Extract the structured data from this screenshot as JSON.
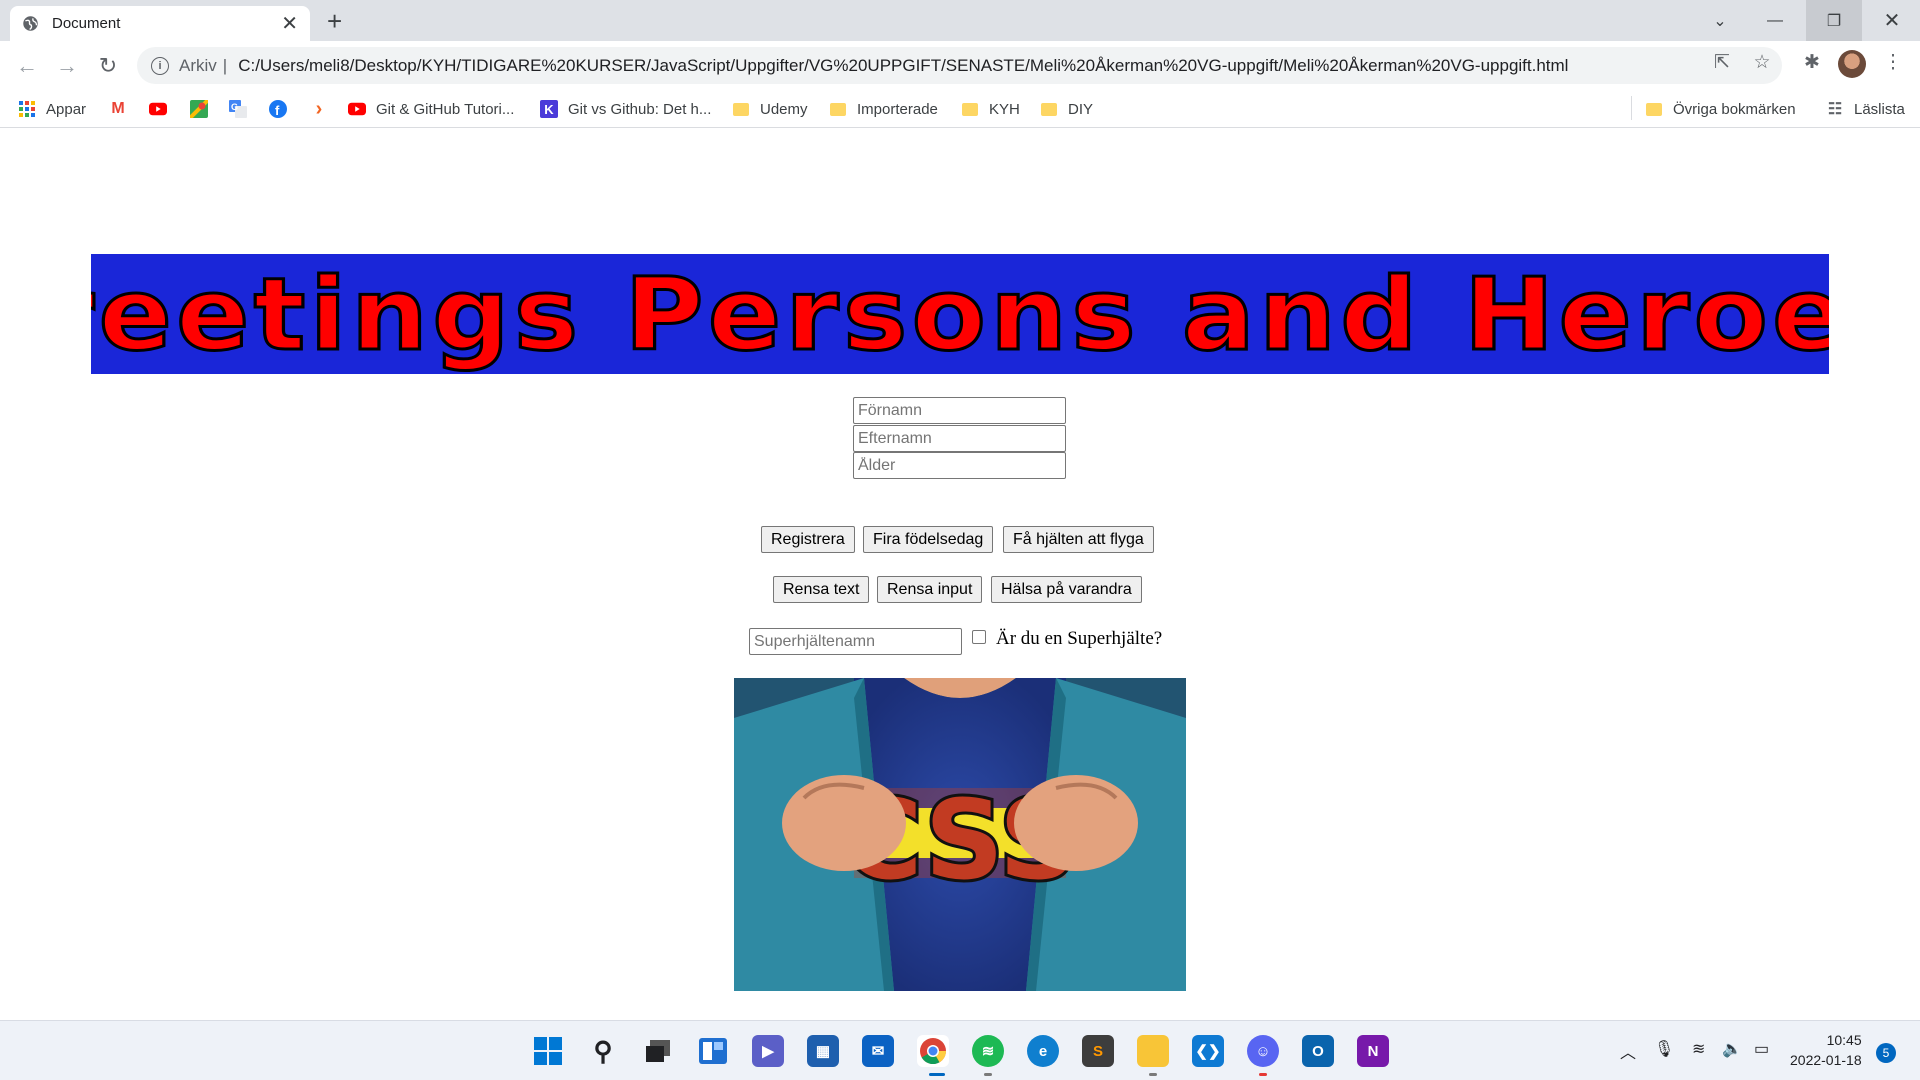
{
  "browser": {
    "tab_title": "Document",
    "address_scheme": "Arkiv",
    "address_url": "C:/Users/meli8/Desktop/KYH/TIDIGARE%20KURSER/JavaScript/Uppgifter/VG%20UPPGIFT/SENASTE/Meli%20Åkerman%20VG-uppgift/Meli%20Åkerman%20VG-uppgift.html",
    "bookmarks": [
      {
        "label": "Appar",
        "icon": "apps-grid-icon"
      },
      {
        "label": "",
        "icon": "gmail-icon"
      },
      {
        "label": "",
        "icon": "youtube-icon"
      },
      {
        "label": "",
        "icon": "maps-icon"
      },
      {
        "label": "",
        "icon": "translate-icon"
      },
      {
        "label": "",
        "icon": "facebook-icon"
      },
      {
        "label": "",
        "icon": "chevron-orange-icon"
      },
      {
        "label": "Git & GitHub Tutori...",
        "icon": "youtube-icon"
      },
      {
        "label": "Git vs Github: Det h...",
        "icon": "k-icon"
      },
      {
        "label": "Udemy",
        "icon": "folder-icon"
      },
      {
        "label": "Importerade",
        "icon": "folder-icon"
      },
      {
        "label": "KYH",
        "icon": "folder-icon"
      },
      {
        "label": "DIY",
        "icon": "folder-icon"
      }
    ],
    "other_bookmarks": "Övriga bokmärken",
    "reading_list": "Läslista"
  },
  "page": {
    "heading": "Greetings Persons and Heroes!",
    "inputs": {
      "firstname_placeholder": "Förnamn",
      "lastname_placeholder": "Efternamn",
      "age_placeholder": "Ålder",
      "heroname_placeholder": "Superhjältenamn"
    },
    "buttons_row1": {
      "register": "Registrera",
      "birthday": "Fira födelsedag",
      "fly": "Få hjälten att flyga"
    },
    "buttons_row2": {
      "clear_text": "Rensa text",
      "clear_input": "Rensa input",
      "greet": "Hälsa på varandra"
    },
    "checkbox_label": "Är du en Superhjälte?",
    "checkbox_checked": false,
    "hero_image_text": "CSS"
  },
  "taskbar": {
    "time": "10:45",
    "date": "2022-01-18",
    "notifications": "5"
  },
  "colors": {
    "banner_bg": "#1a26d8",
    "banner_text": "#ff0000"
  }
}
